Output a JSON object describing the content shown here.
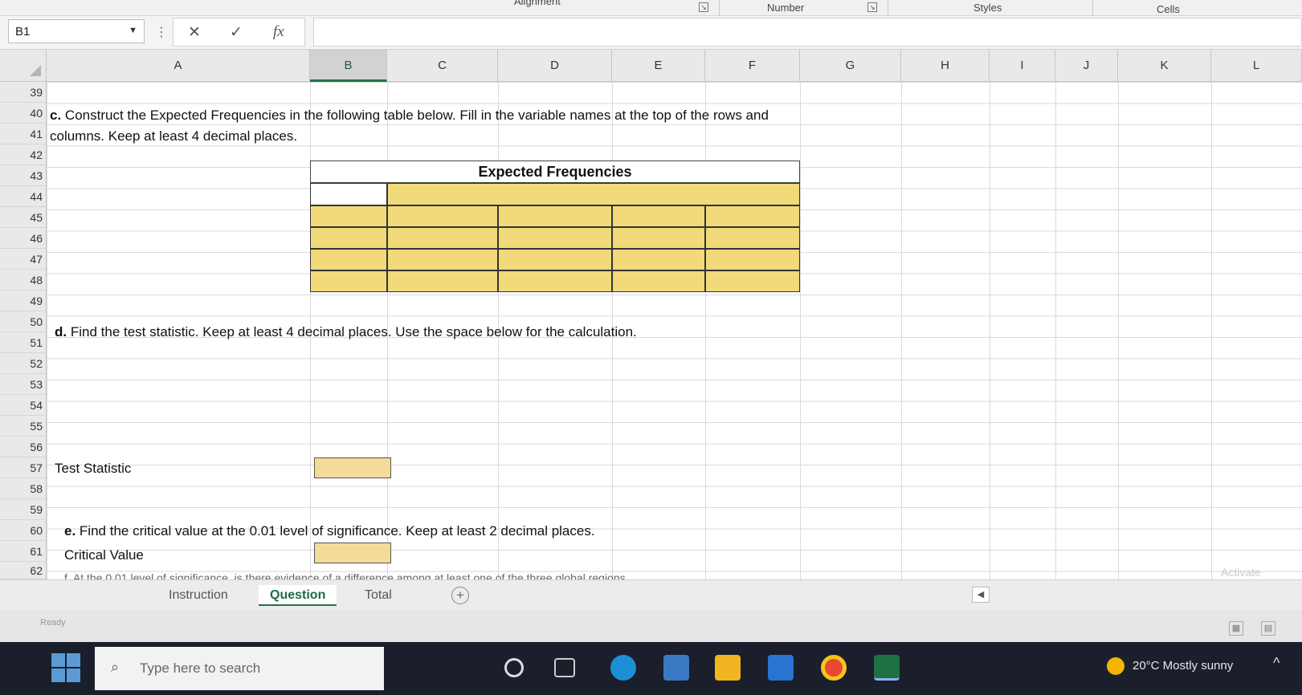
{
  "ribbon": {
    "groups": [
      "Alignment",
      "Number",
      "Styles",
      "Cells"
    ]
  },
  "formula_bar": {
    "name_box": "B1",
    "cancel_icon": "✕",
    "enter_icon": "✓",
    "fx_label": "fx",
    "content": ""
  },
  "columns": [
    "A",
    "B",
    "C",
    "D",
    "E",
    "F",
    "G",
    "H",
    "I",
    "J",
    "K",
    "L"
  ],
  "rows": [
    "39",
    "40",
    "41",
    "42",
    "43",
    "44",
    "45",
    "46",
    "47",
    "48",
    "49",
    "50",
    "51",
    "52",
    "53",
    "54",
    "55",
    "56",
    "57",
    "58",
    "59",
    "60",
    "61",
    "62"
  ],
  "sheet": {
    "line40_prefix": "c.",
    "line40": "Construct the Expected Frequencies in the following table below.  Fill in the variable names at the top of the rows and",
    "line41": "columns.  Keep at least 4 decimal places.",
    "table_title": "Expected Frequencies",
    "line50_prefix": "d.",
    "line50": "Find the test statistic.  Keep at least 4 decimal places.  Use the space below for the calculation.",
    "label_test_statistic": "Test Statistic",
    "line59_prefix": "e.",
    "line59": "Find the critical value at the 0.01 level of significance.  Keep at least 2 decimal places.",
    "label_critical_value": "Critical Value",
    "line62": "f. At the 0.01 level of significance, is there evidence of a difference among at least one of the three global regions"
  },
  "tabs": [
    {
      "label": "Instruction"
    },
    {
      "label": "Question"
    },
    {
      "label": "Total"
    }
  ],
  "status": {
    "ready": "Ready",
    "watermark": "Activate"
  },
  "taskbar": {
    "search_placeholder": "Type here to search",
    "weather": "20°C  Mostly sunny"
  },
  "colors": {
    "excel_green": "#217346",
    "answer_fill": "#f2d97a"
  }
}
